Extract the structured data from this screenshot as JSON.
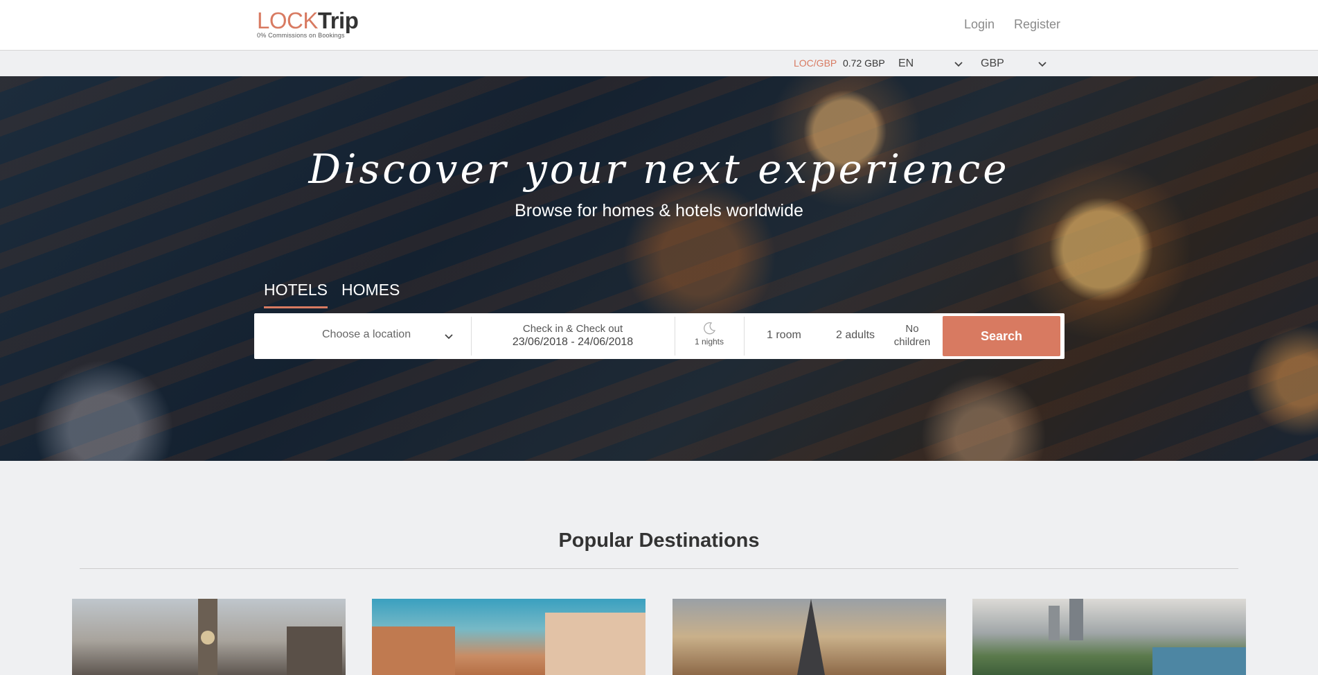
{
  "header": {
    "logo_lock": "LOCK",
    "logo_trip": "Trip",
    "logo_tagline": "0% Commissions on Bookings",
    "login_label": "Login",
    "register_label": "Register"
  },
  "subbar": {
    "rate_label": "LOC/GBP",
    "rate_value": "0.72 GBP",
    "language": "EN",
    "currency": "GBP"
  },
  "hero": {
    "title": "Discover your next experience",
    "subtitle": "Browse for homes & hotels worldwide"
  },
  "tabs": [
    {
      "label": "HOTELS",
      "active": true
    },
    {
      "label": "HOMES",
      "active": false
    }
  ],
  "search": {
    "location_placeholder": "Choose a location",
    "dates_label": "Check in & Check out",
    "dates_value": "23/06/2018 - 24/06/2018",
    "nights": "1 nights",
    "rooms": "1 room",
    "adults": "2 adults",
    "children_line1": "No",
    "children_line2": "children",
    "button_label": "Search"
  },
  "popular": {
    "title": "Popular Destinations"
  },
  "colors": {
    "accent": "#d87a61",
    "page_bg": "#eff0f2"
  }
}
